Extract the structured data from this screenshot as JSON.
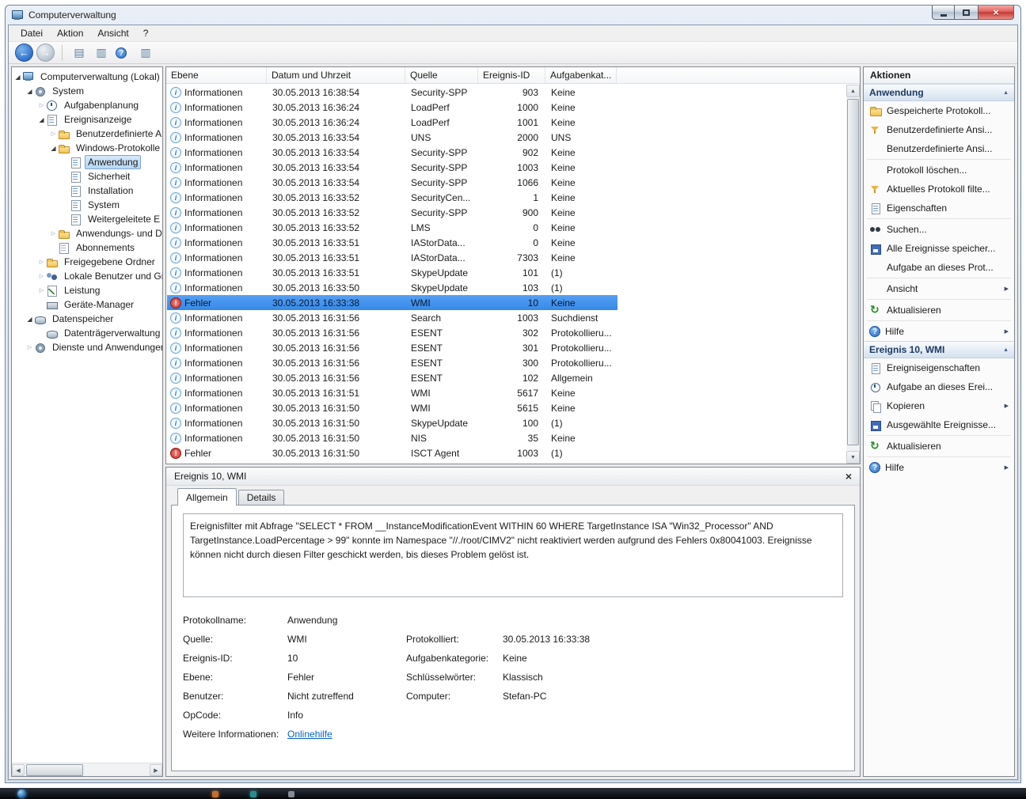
{
  "window": {
    "title": "Computerverwaltung",
    "menu": [
      "Datei",
      "Aktion",
      "Ansicht",
      "?"
    ]
  },
  "toolbar": {
    "buttons": [
      {
        "name": "back",
        "type": "nav-back",
        "glyph": "←"
      },
      {
        "name": "forward",
        "type": "nav-fwd",
        "glyph": "→"
      },
      {
        "name": "separator",
        "type": "sep"
      },
      {
        "name": "export-list",
        "type": "icon",
        "glyph": "▤"
      },
      {
        "name": "console-tree-toggle",
        "type": "icon",
        "glyph": "▥"
      },
      {
        "name": "help",
        "type": "help"
      },
      {
        "name": "action-pane-toggle",
        "type": "icon",
        "glyph": "▥"
      }
    ]
  },
  "tree": {
    "items": [
      {
        "label": "Computerverwaltung (Lokal)",
        "depth": 0,
        "state": "expanded",
        "icon": "computer",
        "selected": false
      },
      {
        "label": "System",
        "depth": 1,
        "state": "expanded",
        "icon": "system",
        "selected": false
      },
      {
        "label": "Aufgabenplanung",
        "depth": 2,
        "state": "collapsed",
        "icon": "task-scheduler",
        "selected": false
      },
      {
        "label": "Ereignisanzeige",
        "depth": 2,
        "state": "expanded",
        "icon": "event-viewer",
        "selected": false
      },
      {
        "label": "Benutzerdefinierte A",
        "depth": 3,
        "state": "collapsed",
        "icon": "folder",
        "selected": false
      },
      {
        "label": "Windows-Protokolle",
        "depth": 3,
        "state": "expanded",
        "icon": "folder",
        "selected": false
      },
      {
        "label": "Anwendung",
        "depth": 4,
        "state": "none",
        "icon": "log",
        "selected": true
      },
      {
        "label": "Sicherheit",
        "depth": 4,
        "state": "none",
        "icon": "log",
        "selected": false
      },
      {
        "label": "Installation",
        "depth": 4,
        "state": "none",
        "icon": "log",
        "selected": false
      },
      {
        "label": "System",
        "depth": 4,
        "state": "none",
        "icon": "log",
        "selected": false
      },
      {
        "label": "Weitergeleitete E",
        "depth": 4,
        "state": "none",
        "icon": "log",
        "selected": false
      },
      {
        "label": "Anwendungs- und D",
        "depth": 3,
        "state": "collapsed",
        "icon": "folder",
        "selected": false
      },
      {
        "label": "Abonnements",
        "depth": 3,
        "state": "none",
        "icon": "page",
        "selected": false
      },
      {
        "label": "Freigegebene Ordner",
        "depth": 2,
        "state": "collapsed",
        "icon": "shared-folder",
        "selected": false
      },
      {
        "label": "Lokale Benutzer und Gr",
        "depth": 2,
        "state": "collapsed",
        "icon": "users",
        "selected": false
      },
      {
        "label": "Leistung",
        "depth": 2,
        "state": "collapsed",
        "icon": "performance",
        "selected": false
      },
      {
        "label": "Geräte-Manager",
        "depth": 2,
        "state": "none",
        "icon": "device-manager",
        "selected": false
      },
      {
        "label": "Datenspeicher",
        "depth": 1,
        "state": "expanded",
        "icon": "storage",
        "selected": false
      },
      {
        "label": "Datenträgerverwaltung",
        "depth": 2,
        "state": "none",
        "icon": "disk",
        "selected": false
      },
      {
        "label": "Dienste und Anwendungen",
        "depth": 1,
        "state": "collapsed",
        "icon": "services",
        "selected": false
      }
    ]
  },
  "events": {
    "columns": [
      "Ebene",
      "Datum und Uhrzeit",
      "Quelle",
      "Ereignis-ID",
      "Aufgabenkat..."
    ],
    "selected_index": 14,
    "rows": [
      {
        "level": "Informationen",
        "datetime": "30.05.2013 16:38:54",
        "source": "Security-SPP",
        "event_id": "903",
        "category": "Keine"
      },
      {
        "level": "Informationen",
        "datetime": "30.05.2013 16:36:24",
        "source": "LoadPerf",
        "event_id": "1000",
        "category": "Keine"
      },
      {
        "level": "Informationen",
        "datetime": "30.05.2013 16:36:24",
        "source": "LoadPerf",
        "event_id": "1001",
        "category": "Keine"
      },
      {
        "level": "Informationen",
        "datetime": "30.05.2013 16:33:54",
        "source": "UNS",
        "event_id": "2000",
        "category": "UNS"
      },
      {
        "level": "Informationen",
        "datetime": "30.05.2013 16:33:54",
        "source": "Security-SPP",
        "event_id": "902",
        "category": "Keine"
      },
      {
        "level": "Informationen",
        "datetime": "30.05.2013 16:33:54",
        "source": "Security-SPP",
        "event_id": "1003",
        "category": "Keine"
      },
      {
        "level": "Informationen",
        "datetime": "30.05.2013 16:33:54",
        "source": "Security-SPP",
        "event_id": "1066",
        "category": "Keine"
      },
      {
        "level": "Informationen",
        "datetime": "30.05.2013 16:33:52",
        "source": "SecurityCen...",
        "event_id": "1",
        "category": "Keine"
      },
      {
        "level": "Informationen",
        "datetime": "30.05.2013 16:33:52",
        "source": "Security-SPP",
        "event_id": "900",
        "category": "Keine"
      },
      {
        "level": "Informationen",
        "datetime": "30.05.2013 16:33:52",
        "source": "LMS",
        "event_id": "0",
        "category": "Keine"
      },
      {
        "level": "Informationen",
        "datetime": "30.05.2013 16:33:51",
        "source": "IAStorData...",
        "event_id": "0",
        "category": "Keine"
      },
      {
        "level": "Informationen",
        "datetime": "30.05.2013 16:33:51",
        "source": "IAStorData...",
        "event_id": "7303",
        "category": "Keine"
      },
      {
        "level": "Informationen",
        "datetime": "30.05.2013 16:33:51",
        "source": "SkypeUpdate",
        "event_id": "101",
        "category": "(1)"
      },
      {
        "level": "Informationen",
        "datetime": "30.05.2013 16:33:50",
        "source": "SkypeUpdate",
        "event_id": "103",
        "category": "(1)"
      },
      {
        "level": "Fehler",
        "datetime": "30.05.2013 16:33:38",
        "source": "WMI",
        "event_id": "10",
        "category": "Keine"
      },
      {
        "level": "Informationen",
        "datetime": "30.05.2013 16:31:56",
        "source": "Search",
        "event_id": "1003",
        "category": "Suchdienst"
      },
      {
        "level": "Informationen",
        "datetime": "30.05.2013 16:31:56",
        "source": "ESENT",
        "event_id": "302",
        "category": "Protokollieru..."
      },
      {
        "level": "Informationen",
        "datetime": "30.05.2013 16:31:56",
        "source": "ESENT",
        "event_id": "301",
        "category": "Protokollieru..."
      },
      {
        "level": "Informationen",
        "datetime": "30.05.2013 16:31:56",
        "source": "ESENT",
        "event_id": "300",
        "category": "Protokollieru..."
      },
      {
        "level": "Informationen",
        "datetime": "30.05.2013 16:31:56",
        "source": "ESENT",
        "event_id": "102",
        "category": "Allgemein"
      },
      {
        "level": "Informationen",
        "datetime": "30.05.2013 16:31:51",
        "source": "WMI",
        "event_id": "5617",
        "category": "Keine"
      },
      {
        "level": "Informationen",
        "datetime": "30.05.2013 16:31:50",
        "source": "WMI",
        "event_id": "5615",
        "category": "Keine"
      },
      {
        "level": "Informationen",
        "datetime": "30.05.2013 16:31:50",
        "source": "SkypeUpdate",
        "event_id": "100",
        "category": "(1)"
      },
      {
        "level": "Informationen",
        "datetime": "30.05.2013 16:31:50",
        "source": "NIS",
        "event_id": "35",
        "category": "Keine"
      },
      {
        "level": "Fehler",
        "datetime": "30.05.2013 16:31:50",
        "source": "ISCT Agent",
        "event_id": "1003",
        "category": "(1)"
      }
    ]
  },
  "details": {
    "title": "Ereignis 10, WMI",
    "tabs": [
      "Allgemein",
      "Details"
    ],
    "active_tab": "Allgemein",
    "description": "Ereignisfilter mit Abfrage \"SELECT * FROM __InstanceModificationEvent WITHIN 60 WHERE TargetInstance ISA \"Win32_Processor\" AND TargetInstance.LoadPercentage > 99\" konnte im Namespace \"//./root/CIMV2\" nicht reaktiviert werden aufgrund des Fehlers 0x80041003. Ereignisse können nicht durch diesen Filter geschickt werden, bis dieses Problem gelöst ist.",
    "fields": [
      {
        "label": "Protokollname:",
        "value": "Anwendung",
        "label2": "",
        "value2": ""
      },
      {
        "label": "Quelle:",
        "value": "WMI",
        "label2": "Protokolliert:",
        "value2": "30.05.2013 16:33:38"
      },
      {
        "label": "Ereignis-ID:",
        "value": "10",
        "label2": "Aufgabenkategorie:",
        "value2": "Keine"
      },
      {
        "label": "Ebene:",
        "value": "Fehler",
        "label2": "Schlüsselwörter:",
        "value2": "Klassisch"
      },
      {
        "label": "Benutzer:",
        "value": "Nicht zutreffend",
        "label2": "Computer:",
        "value2": "Stefan-PC"
      },
      {
        "label": "OpCode:",
        "value": "Info",
        "label2": "",
        "value2": ""
      },
      {
        "label": "Weitere Informationen:",
        "value": "Onlinehilfe",
        "label2": "",
        "value2": "",
        "link": true
      }
    ]
  },
  "actions": {
    "title": "Aktionen",
    "sections": [
      {
        "header": "Anwendung",
        "items": [
          {
            "label": "Gespeicherte Protokoll...",
            "icon": "open-folder"
          },
          {
            "label": "Benutzerdefinierte Ansi...",
            "icon": "filter"
          },
          {
            "label": "Benutzerdefinierte Ansi...",
            "icon": "none"
          },
          {
            "label": "Protokoll löschen...",
            "icon": "none",
            "sep_before": true
          },
          {
            "label": "Aktuelles Protokoll filte...",
            "icon": "filter"
          },
          {
            "label": "Eigenschaften",
            "icon": "properties"
          },
          {
            "label": "Suchen...",
            "icon": "find",
            "sep_before": true
          },
          {
            "label": "Alle Ereignisse speicher...",
            "icon": "save"
          },
          {
            "label": "Aufgabe an dieses Prot...",
            "icon": "none"
          },
          {
            "label": "Ansicht",
            "icon": "none",
            "submenu": true,
            "sep_before": true
          },
          {
            "label": "Aktualisieren",
            "icon": "refresh",
            "sep_before": true
          },
          {
            "label": "Hilfe",
            "icon": "help",
            "submenu": true,
            "sep_before": true
          }
        ]
      },
      {
        "header": "Ereignis 10, WMI",
        "items": [
          {
            "label": "Ereigniseigenschaften",
            "icon": "properties"
          },
          {
            "label": "Aufgabe an dieses Erei...",
            "icon": "task"
          },
          {
            "label": "Kopieren",
            "icon": "copy",
            "submenu": true
          },
          {
            "label": "Ausgewählte Ereignisse...",
            "icon": "save"
          },
          {
            "label": "Aktualisieren",
            "icon": "refresh",
            "sep_before": true
          },
          {
            "label": "Hilfe",
            "icon": "help",
            "submenu": true,
            "sep_before": true
          }
        ]
      }
    ]
  }
}
